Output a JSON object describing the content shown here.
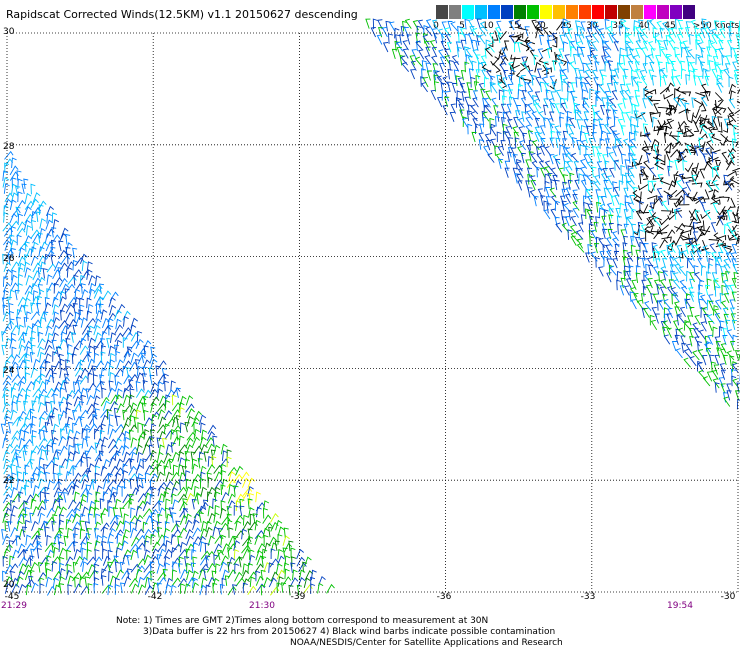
{
  "title": "Rapidscat Corrected Winds(12.5KM) v1.1 20150627 descending",
  "colorbar": {
    "colors": [
      "#474747",
      "#7f7f7f",
      "#00ffff",
      "#00c0ff",
      "#0080ff",
      "#0040c0",
      "#008000",
      "#00c000",
      "#ffff00",
      "#ffc000",
      "#ff8000",
      "#ff4000",
      "#ff0000",
      "#c00000",
      "#804000",
      "#c08040",
      "#ff00ff",
      "#c000c0",
      "#8000c0",
      "#400080"
    ],
    "labels": [
      "0",
      "5",
      "10",
      "15",
      "20",
      "25",
      "30",
      "35",
      "40",
      "45",
      ">50 knots"
    ]
  },
  "lat_labels": [
    "30",
    "28",
    "26",
    "24",
    "22",
    "20"
  ],
  "lon_labels": [
    "-45",
    "-42",
    "-39",
    "-36",
    "-33",
    "-30"
  ],
  "time_labels": [
    "21:29",
    "21:30",
    "19:54"
  ],
  "notes": [
    "Note: 1) Times are GMT 2)Times along bottom correspond to measurement at 30N",
    "3)Data buffer is 22 hrs from 20150627 4) Black wind barbs indicate possible contamination",
    "NOAA/NESDIS/Center for Satellite Applications and Research"
  ],
  "chart_data": {
    "type": "wind-barb-map",
    "lon_range": [
      -45,
      -30
    ],
    "lat_range": [
      20,
      30
    ],
    "speed_units": "knots",
    "grid": true
  }
}
